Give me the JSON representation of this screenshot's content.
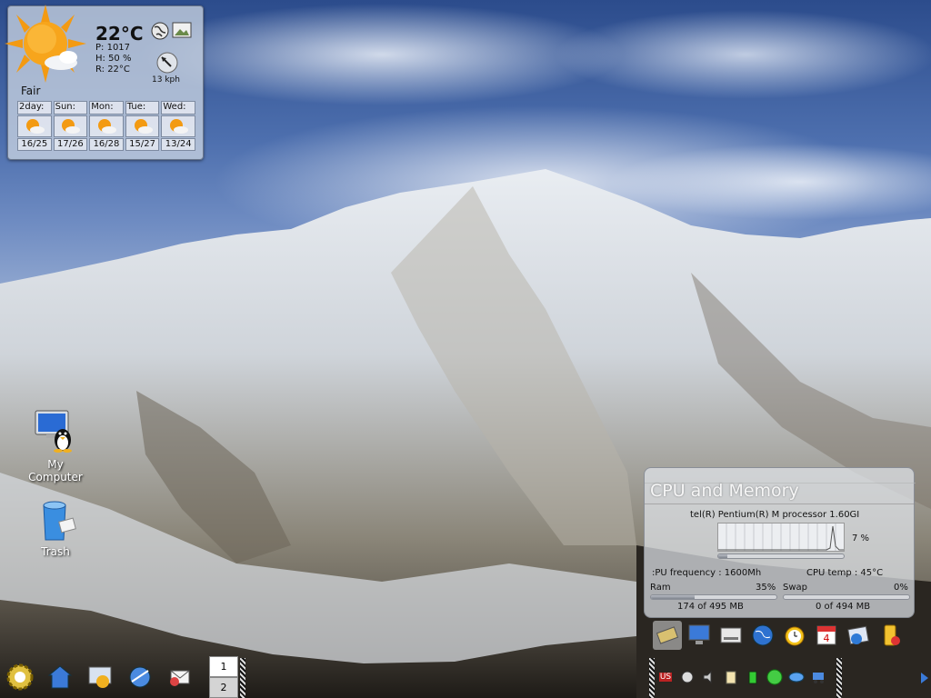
{
  "weather": {
    "temperature": "22°C",
    "pressure": "P: 1017",
    "humidity": "H: 50 %",
    "realfeel": "R: 22°C",
    "wind": "13 kph",
    "condition": "Fair",
    "forecast": [
      {
        "day": "2day:",
        "range": "16/25"
      },
      {
        "day": "Sun:",
        "range": "17/26"
      },
      {
        "day": "Mon:",
        "range": "16/28"
      },
      {
        "day": "Tue:",
        "range": "15/27"
      },
      {
        "day": "Wed:",
        "range": "13/24"
      }
    ]
  },
  "desktop": {
    "my_computer": "My\nComputer",
    "my_computer_l1": "My",
    "my_computer_l2": "Computer",
    "trash": "Trash"
  },
  "cpu": {
    "title": "CPU and Memory",
    "processor": "tel(R) Pentium(R) M processor 1.60GI",
    "usage": "7 %",
    "usage_value": 7,
    "frequency": ":PU frequency : 1600Mh",
    "temp": "CPU temp : 45°C",
    "ram_label": "Ram",
    "ram_pct": "35%",
    "ram_value": 35,
    "ram_detail": "174 of 495 MB",
    "swap_label": "Swap",
    "swap_pct": "0%",
    "swap_value": 0,
    "swap_detail": "0 of 494 MB"
  },
  "pager": {
    "desktop1": "1",
    "desktop2": "2"
  },
  "tray": {
    "keyboard_layout": "US"
  },
  "colors": {
    "sky_top": "#2c4c8c",
    "panel_bg": "#c8d2e0"
  }
}
